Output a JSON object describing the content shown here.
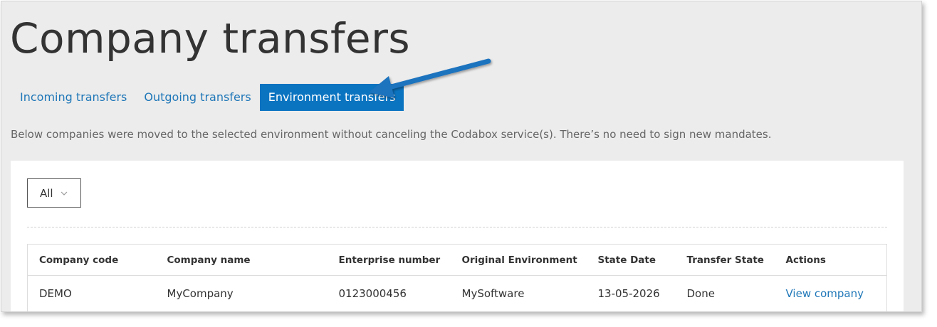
{
  "page": {
    "title": "Company transfers"
  },
  "tabs": [
    {
      "label": "Incoming transfers",
      "active": false
    },
    {
      "label": "Outgoing transfers",
      "active": false
    },
    {
      "label": "Environment transfers",
      "active": true
    }
  ],
  "description": "Below companies were moved to the selected environment without canceling the Codabox service(s). There’s no need to sign new mandates.",
  "filter": {
    "selected": "All",
    "icon": "chevron-down-icon"
  },
  "table": {
    "headers": [
      "Company code",
      "Company name",
      "Enterprise number",
      "Original Environment",
      "State Date",
      "Transfer State",
      "Actions"
    ],
    "rows": [
      {
        "company_code": "DEMO",
        "company_name": "MyCompany",
        "enterprise_number": "0123000456",
        "original_environment": "MySoftware",
        "state_date": "13-05-2026",
        "transfer_state": "Done",
        "action_label": "View company"
      }
    ]
  },
  "colors": {
    "accent": "#0b74c1",
    "link": "#1f77b8",
    "arrow": "#1e73be"
  }
}
